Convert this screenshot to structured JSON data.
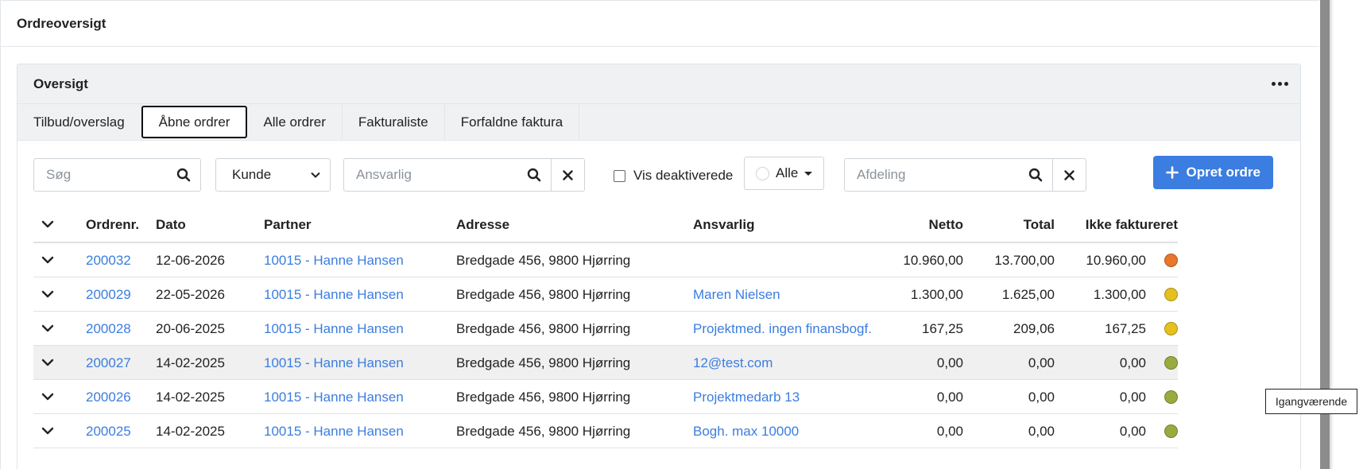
{
  "page": {
    "title": "Ordreoversigt"
  },
  "card": {
    "title": "Oversigt",
    "more_icon": "more-horizontal-icon"
  },
  "tabs": [
    {
      "label": "Tilbud/overslag",
      "active": false
    },
    {
      "label": "Åbne ordrer",
      "active": true
    },
    {
      "label": "Alle ordrer",
      "active": false
    },
    {
      "label": "Fakturaliste",
      "active": false
    },
    {
      "label": "Forfaldne faktura",
      "active": false
    }
  ],
  "filters": {
    "search_placeholder": "Søg",
    "customer_select": "Kunde",
    "responsible_placeholder": "Ansvarlig",
    "show_deactivated_label": "Vis deaktiverede",
    "status_filter_label": "Alle",
    "department_placeholder": "Afdeling",
    "create_button": "Opret ordre"
  },
  "table": {
    "columns": {
      "order_no": "Ordrenr.",
      "date": "Dato",
      "partner": "Partner",
      "address": "Adresse",
      "responsible": "Ansvarlig",
      "net": "Netto",
      "total": "Total",
      "not_invoiced": "Ikke faktureret"
    },
    "rows": [
      {
        "order_no": "200032",
        "date": "12-06-2026",
        "partner": "10015 - Hanne Hansen",
        "address": "Bredgade 456, 9800 Hjørring",
        "responsible": "",
        "net": "10.960,00",
        "total": "13.700,00",
        "not_invoiced": "10.960,00",
        "status_color": "#e8762d"
      },
      {
        "order_no": "200029",
        "date": "22-05-2026",
        "partner": "10015 - Hanne Hansen",
        "address": "Bredgade 456, 9800 Hjørring",
        "responsible": "Maren Nielsen",
        "net": "1.300,00",
        "total": "1.625,00",
        "not_invoiced": "1.300,00",
        "status_color": "#e5c01f"
      },
      {
        "order_no": "200028",
        "date": "20-06-2025",
        "partner": "10015 - Hanne Hansen",
        "address": "Bredgade 456, 9800 Hjørring",
        "responsible": "Projektmed. ingen finansbogf.",
        "net": "167,25",
        "total": "209,06",
        "not_invoiced": "167,25",
        "status_color": "#e5c01f"
      },
      {
        "order_no": "200027",
        "date": "14-02-2025",
        "partner": "10015 - Hanne Hansen",
        "address": "Bredgade 456, 9800 Hjørring",
        "responsible": "12@test.com",
        "net": "0,00",
        "total": "0,00",
        "not_invoiced": "0,00",
        "status_color": "#9aaa3f"
      },
      {
        "order_no": "200026",
        "date": "14-02-2025",
        "partner": "10015 - Hanne Hansen",
        "address": "Bredgade 456, 9800 Hjørring",
        "responsible": "Projektmedarb 13",
        "net": "0,00",
        "total": "0,00",
        "not_invoiced": "0,00",
        "status_color": "#9aaa3f"
      },
      {
        "order_no": "200025",
        "date": "14-02-2025",
        "partner": "10015 - Hanne Hansen",
        "address": "Bredgade 456, 9800 Hjørring",
        "responsible": "Bogh. max 10000",
        "net": "0,00",
        "total": "0,00",
        "not_invoiced": "0,00",
        "status_color": "#9aaa3f"
      }
    ]
  },
  "tooltip": {
    "text": "Igangværende"
  },
  "colors": {
    "accent": "#3b7de0",
    "link": "#3b7de0",
    "hover_row": "#f0f0f0"
  }
}
